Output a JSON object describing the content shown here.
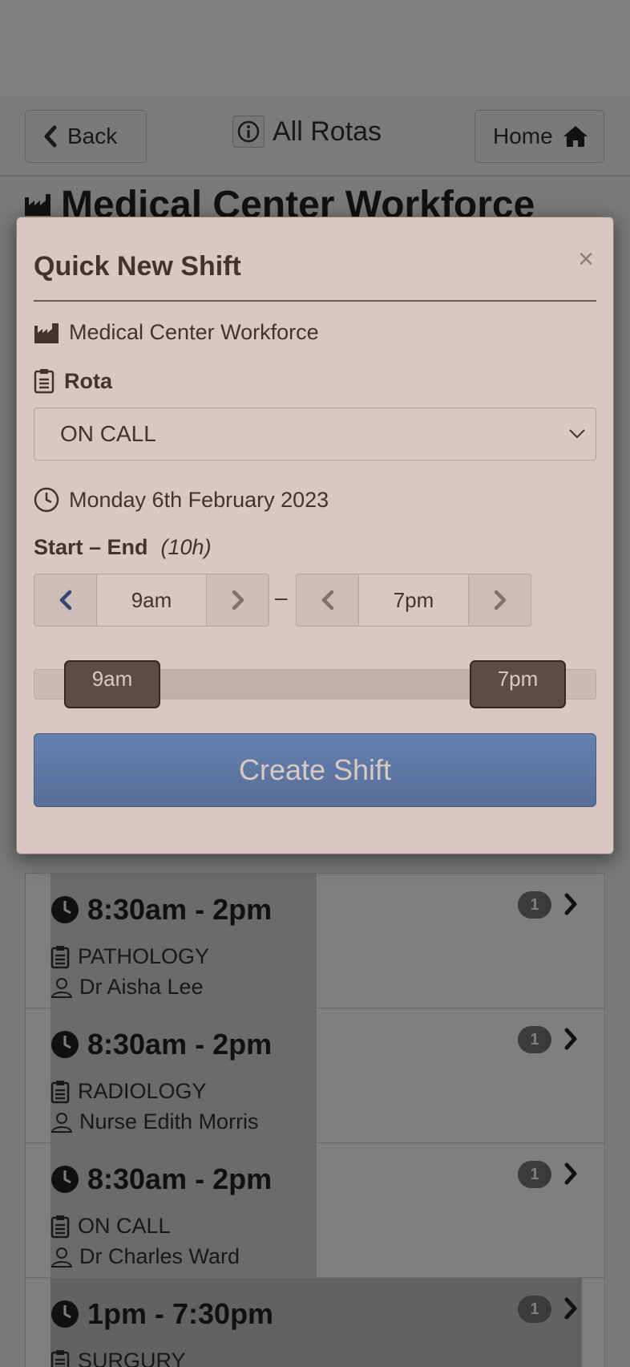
{
  "nav": {
    "back_label": "Back",
    "title": "All Rotas",
    "home_label": "Home"
  },
  "background": {
    "workforce_title": "Medical Center Workforce",
    "shifts": [
      {
        "time": "8:30am - 2pm",
        "rota": "PATHOLOGY",
        "person": "Dr Aisha Lee",
        "badge": "1"
      },
      {
        "time": "8:30am - 2pm",
        "rota": "RADIOLOGY",
        "person": "Nurse Edith Morris",
        "badge": "1"
      },
      {
        "time": "8:30am - 2pm",
        "rota": "ON CALL",
        "person": "Dr Charles Ward",
        "badge": "1"
      },
      {
        "time": "1pm - 7:30pm",
        "rota": "SURGURY",
        "person": "",
        "badge": "1"
      }
    ]
  },
  "modal": {
    "title": "Quick New Shift",
    "close_symbol": "×",
    "workforce": "Medical Center Workforce",
    "rota_label": "Rota",
    "rota_selected": "ON CALL",
    "date": "Monday 6th February 2023",
    "start_end_label": "Start – End",
    "duration": "(10h)",
    "start_time": "9am",
    "end_time": "7pm",
    "separator": "–",
    "slider": {
      "start_label": "9am",
      "end_label": "7pm"
    },
    "create_button": "Create Shift"
  },
  "colors": {
    "primary_button": "#4d84c7",
    "active_chevron": "#1f4f9a",
    "slider_handle": "#555555"
  }
}
